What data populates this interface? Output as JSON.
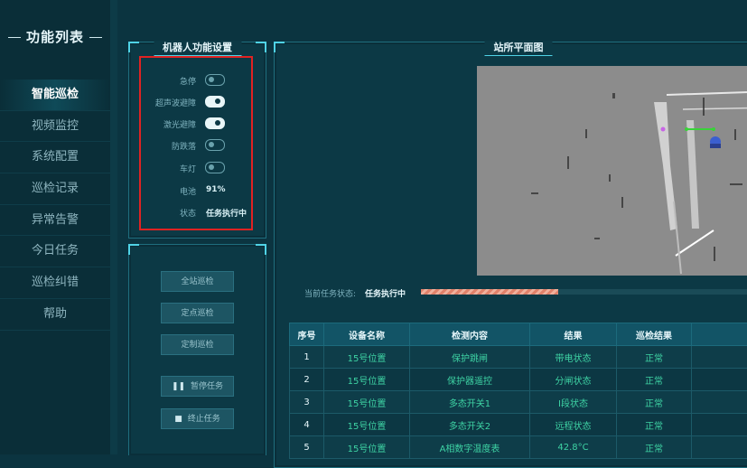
{
  "sidebar": {
    "title": "功能列表",
    "items": [
      {
        "label": "智能巡检",
        "active": true
      },
      {
        "label": "视频监控"
      },
      {
        "label": "系统配置"
      },
      {
        "label": "巡检记录"
      },
      {
        "label": "异常告警"
      },
      {
        "label": "今日任务"
      },
      {
        "label": "巡检纠错"
      },
      {
        "label": "帮助"
      }
    ]
  },
  "robot_settings": {
    "title": "机器人功能设置",
    "emergency_stop": {
      "label": "急停",
      "on": false
    },
    "ultrasonic": {
      "label": "超声波避障",
      "on": true
    },
    "laser": {
      "label": "激光避障",
      "on": true
    },
    "anti_fall": {
      "label": "防跌落",
      "on": false
    },
    "lights": {
      "label": "车灯",
      "on": false
    },
    "battery": {
      "label": "电池",
      "value": "91%"
    },
    "state": {
      "label": "状态",
      "value": "任务执行中"
    }
  },
  "controls": {
    "full_patrol": "全站巡检",
    "point_patrol": "定点巡检",
    "custom_patrol": "定制巡检",
    "pause_task": "暂停任务",
    "stop_task": "终止任务",
    "pause_icon": "pause-icon",
    "stop_icon": "stop-icon"
  },
  "map": {
    "title": "站所平面图",
    "status_label": "当前任务状态:",
    "status_value": "任务执行中",
    "progress": 0.4
  },
  "table": {
    "headers": [
      "序号",
      "设备名称",
      "检测内容",
      "结果",
      "巡检结果"
    ],
    "rows": [
      [
        "1",
        "15号位置",
        "保护跳闸",
        "带电状态",
        "正常"
      ],
      [
        "2",
        "15号位置",
        "保护器遥控",
        "分闸状态",
        "正常"
      ],
      [
        "3",
        "15号位置",
        "多态开关1",
        "I段状态",
        "正常"
      ],
      [
        "4",
        "15号位置",
        "多态开关2",
        "远程状态",
        "正常"
      ],
      [
        "5",
        "15号位置",
        "A相数字温度表",
        "42.8°C",
        "正常"
      ]
    ]
  },
  "colors": {
    "background": "#0b3440",
    "accent": "#4fd3e6",
    "value_green": "#3ed3a4",
    "highlight_red": "#e02222"
  }
}
